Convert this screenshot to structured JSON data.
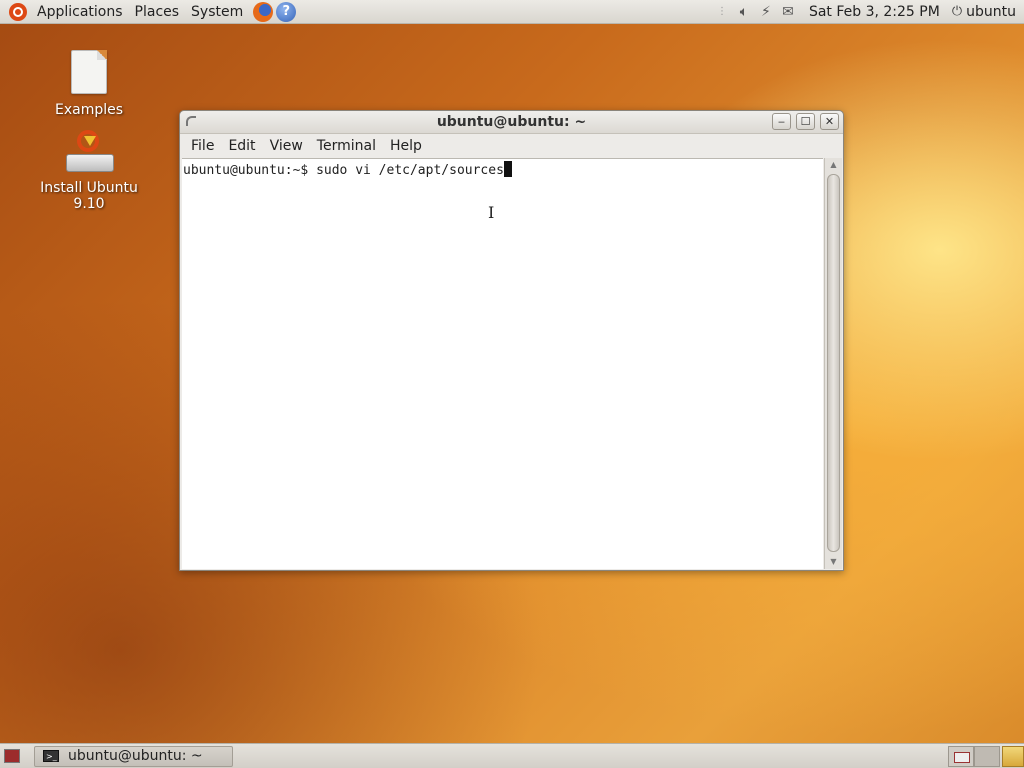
{
  "top_panel": {
    "menus": [
      "Applications",
      "Places",
      "System"
    ],
    "launchers": [
      "firefox-icon",
      "help-icon"
    ],
    "tray_icons": [
      "volume-icon",
      "network-icon",
      "mail-icon"
    ],
    "clock": "Sat Feb  3,  2:25 PM",
    "user": "ubuntu"
  },
  "desktop": {
    "icons": [
      {
        "label": "Examples",
        "icon": "document-icon"
      },
      {
        "label": "Install Ubuntu 9.10",
        "icon": "install-icon"
      }
    ]
  },
  "terminal": {
    "title": "ubuntu@ubuntu: ~",
    "menu": [
      "File",
      "Edit",
      "View",
      "Terminal",
      "Help"
    ],
    "prompt": "ubuntu@ubuntu:~$ ",
    "command": "sudo vi /etc/apt/sources"
  },
  "bottom_panel": {
    "task_label": "ubuntu@ubuntu: ~",
    "workspace_count": 2,
    "active_workspace": 1
  },
  "colors": {
    "accent": "#dd4814",
    "desktop_bg": "#de8a2c"
  }
}
